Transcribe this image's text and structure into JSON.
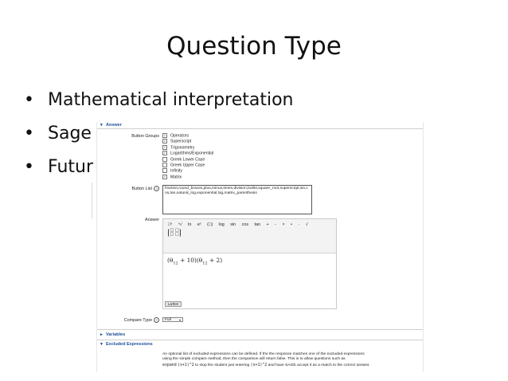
{
  "slide": {
    "title": "Question Type",
    "bullets": [
      {
        "dot": "•",
        "text": "Mathematical interpretation"
      },
      {
        "dot": "•",
        "text": "Sage"
      },
      {
        "dot": "•",
        "text": "Futur"
      }
    ]
  },
  "form": {
    "answer_section": {
      "label": "Answer",
      "icon": "chevron-down-icon"
    },
    "button_groups": {
      "label": "Button Groups",
      "items": [
        {
          "label": "Operators",
          "checked": true,
          "mark": "✓"
        },
        {
          "label": "Superscript",
          "checked": true,
          "mark": "✓"
        },
        {
          "label": "Trigonometry",
          "checked": true,
          "mark": "✓"
        },
        {
          "label": "Logarithms/Exponential",
          "checked": true,
          "mark": "✓"
        },
        {
          "label": "Greek Lower Case",
          "checked": false,
          "mark": ""
        },
        {
          "label": "Greek Upper Case",
          "checked": false,
          "mark": ""
        },
        {
          "label": "Infinity",
          "checked": false,
          "mark": ""
        },
        {
          "label": "Matrix",
          "checked": true,
          "mark": "✓"
        }
      ]
    },
    "button_list": {
      "label": "Button List",
      "help": "?",
      "value": "fraction,round_braces,plus,minus,times,division,bullet,square_root,superscript,sin,cos,tan,natural_log,exponential,log,matrix_parenthesis"
    },
    "answer": {
      "label": "Answer",
      "toolbar": [
        "□ⁿ",
        "ⁿ√",
        "ln",
        "eˣ",
        "(□)",
        "log",
        "sin",
        "cos",
        "tan",
        "+",
        "-",
        "×",
        "•",
        "·",
        "√"
      ],
      "matrix_cells": [
        "□ □",
        "□ □"
      ],
      "expr_parts": {
        "p1": "(θ",
        "s1": "12",
        "p2": " + 10)(θ",
        "s2": "12",
        "p3": " + 2)"
      },
      "latex_tab": "LaTeX"
    },
    "compare_type": {
      "label": "Compare Type",
      "help": "?",
      "value": "Full",
      "arrow": "▾"
    },
    "variables_section": {
      "label": "Variables",
      "icon": "chevron-right-icon"
    },
    "excluded_section": {
      "label": "Excluded Expressions",
      "icon": "chevron-down-icon"
    },
    "excluded_text": {
      "l1": "An optional list of excluded expressions can be defined. If the the response matches one of the excluded expressions",
      "l2": "using the simple compare method, then the comparison will return false. This is to allow questions such as",
      "l3a": "expand",
      "l3b": "(x+1)^2",
      "l3c": " to stop the student just entering ",
      "l3d": "(x+1)^2",
      "l3e": " and have SAGE accept it as a match to the correct answer."
    }
  }
}
